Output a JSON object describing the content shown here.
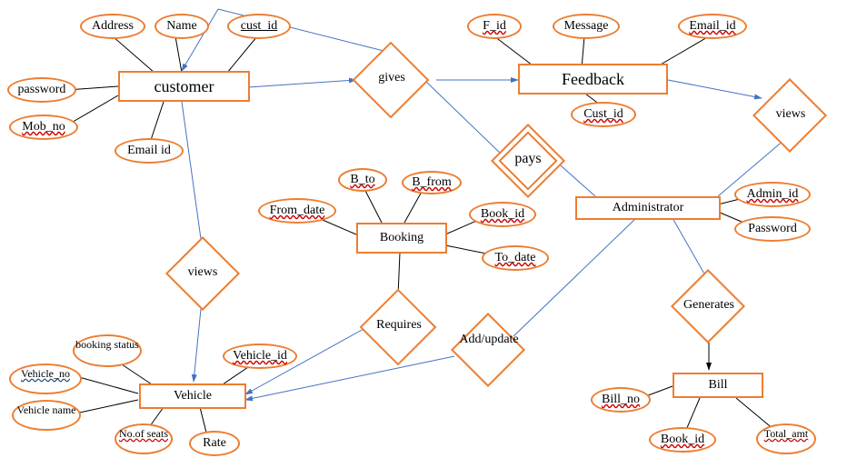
{
  "diagram_type": "er-diagram",
  "entities": {
    "customer": {
      "label": "customer",
      "attributes": {
        "address": "Address",
        "name": "Name",
        "cust_id": "cust_id",
        "password": "password",
        "mob_no": "Mob_no",
        "email_id": "Email id"
      }
    },
    "feedback": {
      "label": "Feedback",
      "attributes": {
        "f_id": "F_id",
        "message": "Message",
        "email_id": "Email_id",
        "cust_id": "Cust_id"
      }
    },
    "administrator": {
      "label": "Administrator",
      "attributes": {
        "admin_id": "Admin_id",
        "password": "Password"
      }
    },
    "booking": {
      "label": "Booking",
      "attributes": {
        "b_to": "B_to",
        "b_from": "B_from",
        "from_date": "From_date",
        "book_id": "Book_id",
        "to_date": "To_date"
      }
    },
    "vehicle": {
      "label": "Vehicle",
      "attributes": {
        "booking_status": "booking status",
        "vehicle_no": "Vehicle_no",
        "vehicle_name": "Vehicle name",
        "no_of_seats": "No.of seats",
        "vehicle_id": "Vehicle_id",
        "rate": "Rate"
      }
    },
    "bill": {
      "label": "Bill",
      "attributes": {
        "bill_no": "Bill_no",
        "book_id": "Book_id",
        "total_amt": "Total_amt"
      }
    }
  },
  "relationships": {
    "gives": {
      "label": "gives",
      "connects": [
        "customer",
        "feedback"
      ]
    },
    "views_feedback": {
      "label": "views",
      "connects": [
        "administrator",
        "feedback"
      ]
    },
    "pays": {
      "label": "pays",
      "connects": [
        "customer",
        "administrator"
      ]
    },
    "views_vehicle": {
      "label": "views",
      "connects": [
        "customer",
        "vehicle"
      ]
    },
    "requires": {
      "label": "Requires",
      "connects": [
        "booking",
        "vehicle"
      ]
    },
    "add_update": {
      "label": "Add/update",
      "connects": [
        "administrator",
        "vehicle"
      ]
    },
    "generates": {
      "label": "Generates",
      "connects": [
        "administrator",
        "bill"
      ]
    }
  },
  "chart_data": {
    "type": "er-diagram",
    "entities": [
      {
        "name": "customer",
        "primary_key": "cust_id",
        "attributes": [
          "Address",
          "Name",
          "cust_id",
          "password",
          "Mob_no",
          "Email id"
        ]
      },
      {
        "name": "Feedback",
        "primary_key": "F_id",
        "attributes": [
          "F_id",
          "Message",
          "Email_id",
          "Cust_id"
        ]
      },
      {
        "name": "Administrator",
        "primary_key": "Admin_id",
        "attributes": [
          "Admin_id",
          "Password"
        ]
      },
      {
        "name": "Booking",
        "primary_key": "Book_id",
        "attributes": [
          "B_to",
          "B_from",
          "From_date",
          "Book_id",
          "To_date"
        ]
      },
      {
        "name": "Vehicle",
        "primary_key": "Vehicle_id",
        "attributes": [
          "booking status",
          "Vehicle_no",
          "Vehicle name",
          "No.of seats",
          "Vehicle_id",
          "Rate"
        ]
      },
      {
        "name": "Bill",
        "primary_key": "Bill_no",
        "attributes": [
          "Bill_no",
          "Book_id",
          "Total_amt"
        ]
      }
    ],
    "relationships": [
      {
        "name": "gives",
        "between": [
          "customer",
          "Feedback"
        ]
      },
      {
        "name": "views",
        "between": [
          "Administrator",
          "Feedback"
        ]
      },
      {
        "name": "pays",
        "between": [
          "customer",
          "Administrator"
        ]
      },
      {
        "name": "views",
        "between": [
          "customer",
          "Vehicle"
        ]
      },
      {
        "name": "Requires",
        "between": [
          "Booking",
          "Vehicle"
        ]
      },
      {
        "name": "Add/update",
        "between": [
          "Administrator",
          "Vehicle"
        ]
      },
      {
        "name": "Generates",
        "between": [
          "Administrator",
          "Bill"
        ]
      }
    ]
  }
}
